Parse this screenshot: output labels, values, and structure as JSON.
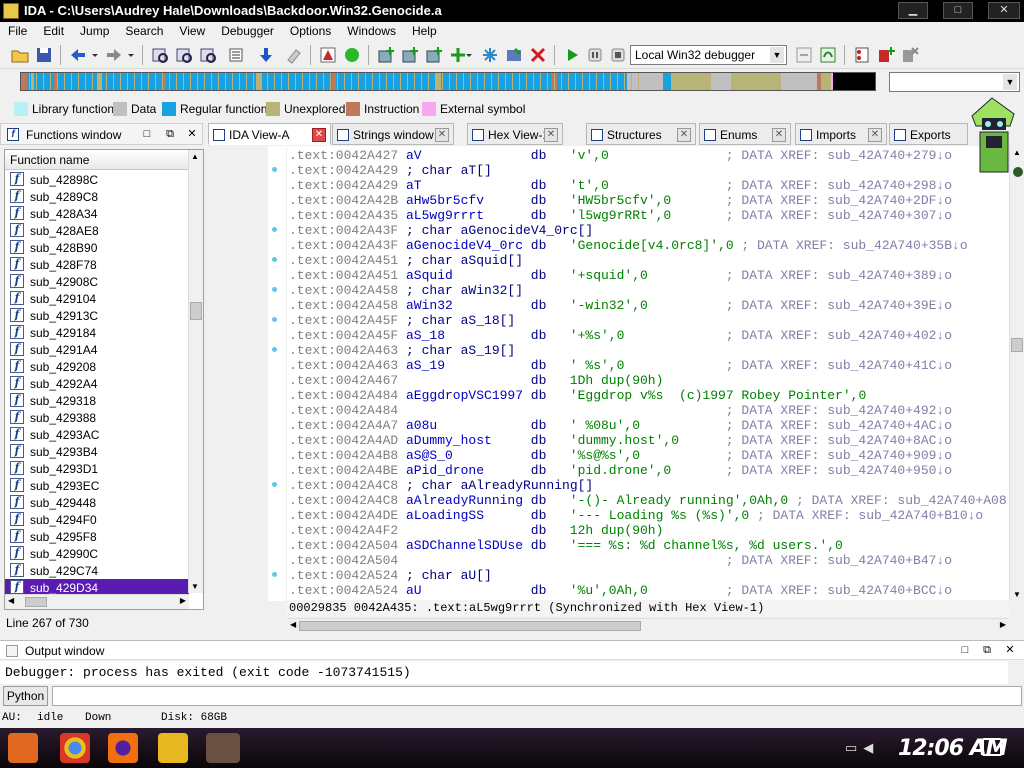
{
  "window": {
    "title": "IDA - C:\\Users\\Audrey Hale\\Downloads\\Backdoor.Win32.Genocide.a",
    "controls": [
      "▁",
      "□",
      "✕"
    ]
  },
  "menu": [
    "File",
    "Edit",
    "Jump",
    "Search",
    "View",
    "Debugger",
    "Options",
    "Windows",
    "Help"
  ],
  "toolbar": {
    "debugger_select": "Local Win32 debugger"
  },
  "legend": [
    {
      "label": "Library function",
      "color": "#b8f0f4"
    },
    {
      "label": "Data",
      "color": "#c0c0c0"
    },
    {
      "label": "Regular function",
      "color": "#1aa2e0"
    },
    {
      "label": "Unexplored",
      "color": "#b8b478"
    },
    {
      "label": "Instruction",
      "color": "#c0785a"
    },
    {
      "label": "External symbol",
      "color": "#f8a8f0"
    }
  ],
  "functions_window": {
    "title": "Functions window",
    "column_header": "Function name",
    "items": [
      "sub_42898C",
      "sub_4289C8",
      "sub_428A34",
      "sub_428AE8",
      "sub_428B90",
      "sub_428F78",
      "sub_42908C",
      "sub_429104",
      "sub_42913C",
      "sub_429184",
      "sub_4291A4",
      "sub_429208",
      "sub_4292A4",
      "sub_429318",
      "sub_429388",
      "sub_4293AC",
      "sub_4293B4",
      "sub_4293D1",
      "sub_4293EC",
      "sub_429448",
      "sub_4294F0",
      "sub_4295F8",
      "sub_42990C",
      "sub_429C74",
      "sub_429D34"
    ],
    "selected_index": 24,
    "line_status": "Line 267 of 730"
  },
  "tabs": [
    {
      "label": "IDA View-A",
      "active": true
    },
    {
      "label": "Strings window",
      "active": false
    },
    {
      "label": "Hex View-1",
      "active": false
    },
    {
      "label": "Structures",
      "active": false
    },
    {
      "label": "Enums",
      "active": false
    },
    {
      "label": "Imports",
      "active": false
    },
    {
      "label": "Exports",
      "active": false
    }
  ],
  "disassembly": [
    {
      "addr": ".text:0042A427",
      "name": "aV",
      "op": "db",
      "arg": "'v',0",
      "cmt": "; DATA XREF: sub_42A740+279↓o"
    },
    {
      "addr": ".text:0042A429",
      "name": "; char aT[]",
      "op": "",
      "arg": "",
      "cmt": ""
    },
    {
      "addr": ".text:0042A429",
      "name": "aT",
      "op": "db",
      "arg": "'t',0",
      "cmt": "; DATA XREF: sub_42A740+298↓o"
    },
    {
      "addr": ".text:0042A42B",
      "name": "aHw5br5cfv",
      "op": "db",
      "arg": "'HW5br5cfv',0",
      "cmt": "; DATA XREF: sub_42A740+2DF↓o"
    },
    {
      "addr": ".text:0042A435",
      "name": "aL5wg9rrrt",
      "op": "db",
      "arg": "'l5wg9rRRt',0",
      "cmt": "; DATA XREF: sub_42A740+307↓o"
    },
    {
      "addr": ".text:0042A43F",
      "name": "; char aGenocideV4_0rc[]",
      "op": "",
      "arg": "",
      "cmt": ""
    },
    {
      "addr": ".text:0042A43F",
      "name": "aGenocideV4_0rc",
      "op": "db",
      "arg": "'Genocide[v4.0rc8]',0",
      "cmt": "; DATA XREF: sub_42A740+35B↓o"
    },
    {
      "addr": ".text:0042A451",
      "name": "; char aSquid[]",
      "op": "",
      "arg": "",
      "cmt": ""
    },
    {
      "addr": ".text:0042A451",
      "name": "aSquid",
      "op": "db",
      "arg": "'+squid',0",
      "cmt": "; DATA XREF: sub_42A740+389↓o"
    },
    {
      "addr": ".text:0042A458",
      "name": "; char aWin32[]",
      "op": "",
      "arg": "",
      "cmt": ""
    },
    {
      "addr": ".text:0042A458",
      "name": "aWin32",
      "op": "db",
      "arg": "'-win32',0",
      "cmt": "; DATA XREF: sub_42A740+39E↓o"
    },
    {
      "addr": ".text:0042A45F",
      "name": "; char aS_18[]",
      "op": "",
      "arg": "",
      "cmt": ""
    },
    {
      "addr": ".text:0042A45F",
      "name": "aS_18",
      "op": "db",
      "arg": "'+%s',0",
      "cmt": "; DATA XREF: sub_42A740+402↓o"
    },
    {
      "addr": ".text:0042A463",
      "name": "; char aS_19[]",
      "op": "",
      "arg": "",
      "cmt": ""
    },
    {
      "addr": ".text:0042A463",
      "name": "aS_19",
      "op": "db",
      "arg": "' %s',0",
      "cmt": "; DATA XREF: sub_42A740+41C↓o"
    },
    {
      "addr": ".text:0042A467",
      "name": "",
      "op": "db",
      "arg": "1Dh dup(90h)",
      "cmt": ""
    },
    {
      "addr": ".text:0042A484",
      "name": "aEggdropVSC1997",
      "op": "db",
      "arg": "'Eggdrop v%s  (c)1997 Robey Pointer',0",
      "cmt": ""
    },
    {
      "addr": ".text:0042A484",
      "name": "",
      "op": "",
      "arg": "",
      "cmt": "; DATA XREF: sub_42A740+492↓o"
    },
    {
      "addr": ".text:0042A4A7",
      "name": "a08u",
      "op": "db",
      "arg": "' %08u',0",
      "cmt": "; DATA XREF: sub_42A740+4AC↓o"
    },
    {
      "addr": ".text:0042A4AD",
      "name": "aDummy_host",
      "op": "db",
      "arg": "'dummy.host',0",
      "cmt": "; DATA XREF: sub_42A740+8AC↓o"
    },
    {
      "addr": ".text:0042A4B8",
      "name": "aS@S_0",
      "op": "db",
      "arg": "'%s@%s',0",
      "cmt": "; DATA XREF: sub_42A740+909↓o"
    },
    {
      "addr": ".text:0042A4BE",
      "name": "aPid_drone",
      "op": "db",
      "arg": "'pid.drone',0",
      "cmt": "; DATA XREF: sub_42A740+950↓o"
    },
    {
      "addr": ".text:0042A4C8",
      "name": "; char aAlreadyRunning[]",
      "op": "",
      "arg": "",
      "cmt": ""
    },
    {
      "addr": ".text:0042A4C8",
      "name": "aAlreadyRunning",
      "op": "db",
      "arg": "'-()- Already running',0Ah,0",
      "cmt": "; DATA XREF: sub_42A740+A08"
    },
    {
      "addr": ".text:0042A4DE",
      "name": "aLoadingSS",
      "op": "db",
      "arg": "'--- Loading %s (%s)',0",
      "cmt": "; DATA XREF: sub_42A740+B10↓o"
    },
    {
      "addr": ".text:0042A4F2",
      "name": "",
      "op": "db",
      "arg": "12h dup(90h)",
      "cmt": ""
    },
    {
      "addr": ".text:0042A504",
      "name": "aSDChannelSDUse",
      "op": "db",
      "arg": "'=== %s: %d channel%s, %d users.',0",
      "cmt": ""
    },
    {
      "addr": ".text:0042A504",
      "name": "",
      "op": "",
      "arg": "",
      "cmt": "; DATA XREF: sub_42A740+B47↓o"
    },
    {
      "addr": ".text:0042A524",
      "name": "; char aU[]",
      "op": "",
      "arg": "",
      "cmt": ""
    },
    {
      "addr": ".text:0042A524",
      "name": "aU",
      "op": "db",
      "arg": "'%u',0Ah,0",
      "cmt": "; DATA XREF: sub_42A740+BCC↓o"
    }
  ],
  "status_line": "00029835 0042A435: .text:aL5wg9rrrt (Synchronized with Hex View-1)",
  "output_window": {
    "title": "Output window",
    "text": "Debugger: process has exited (exit code -1073741515)",
    "python_button": "Python"
  },
  "status_strip": {
    "au": "AU:",
    "state": "idle",
    "dir": "Down",
    "disk": "Disk: 68GB"
  },
  "taskbar": {
    "clock": "12:06 AM"
  }
}
